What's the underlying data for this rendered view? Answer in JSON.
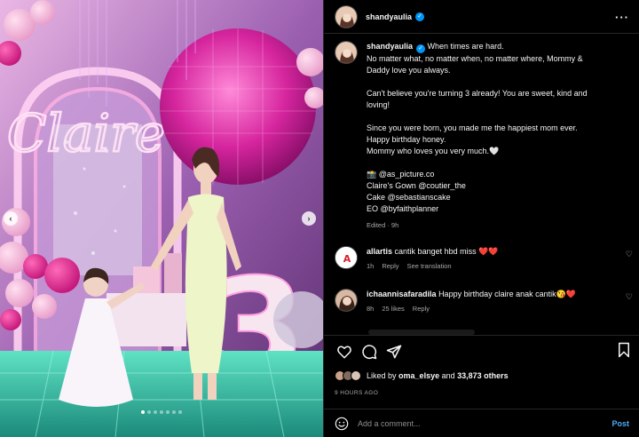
{
  "header": {
    "username": "shandyaulia",
    "verified_icon": "verified-badge-icon",
    "more_icon": "more-options-icon"
  },
  "photo": {
    "carousel_dots": 7,
    "active_dot": 0
  },
  "caption": {
    "username": "shandyaulia",
    "lines": [
      "When times are hard.",
      "No matter what, no matter when, no matter where, Mommy &",
      "Daddy love you always.",
      "",
      "Can't believe you're turning 3 already! You are sweet, kind and",
      "loving!",
      "",
      "Since you were born, you made me the happiest mom ever.",
      "Happy birthday honey.",
      "Mommy who loves you very much.🤍",
      "",
      "📸 @as_picture.co",
      "Claire's Gown @coutier_the",
      "Cake @sebastianscake",
      "EO @byfaithplanner"
    ],
    "meta": "Edited · 9h"
  },
  "comments": [
    {
      "username": "allartis",
      "text": "cantik banget hbd miss",
      "hearts": "❤️❤️",
      "time": "1h",
      "reply_label": "Reply",
      "extra_label": "See translation",
      "avatar_text": "A"
    },
    {
      "username": "ichaannisafaradila",
      "text": "Happy birthday claire anak cantik😘❤️",
      "time": "8h",
      "likes_label": "25 likes",
      "reply_label": "Reply"
    }
  ],
  "likes": {
    "prefix": "Liked by",
    "user": "oma_elsye",
    "middle": "and",
    "count": "33,873 others"
  },
  "time_ago": "9 HOURS AGO",
  "add_comment": {
    "placeholder": "Add a comment...",
    "post_label": "Post"
  },
  "colors": {
    "background": "#000000",
    "accent_blue": "#0095f6",
    "post_blue": "#4fa9f5",
    "muted": "#a8a8a8",
    "heart_red": "#ff3040"
  }
}
